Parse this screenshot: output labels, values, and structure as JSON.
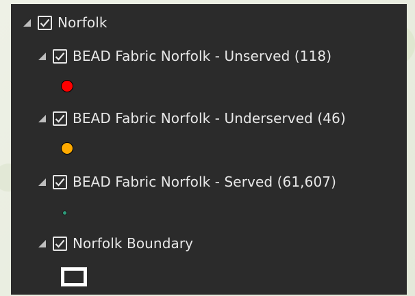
{
  "contents": {
    "group": {
      "label": "Norfolk",
      "checked": true,
      "expanded": true
    },
    "layers": [
      {
        "label": "BEAD Fabric Norfolk - Unserved (118)",
        "checked": true,
        "expanded": true,
        "symbol": {
          "shape": "circle",
          "fill": "#ff0000",
          "outline": "#000000",
          "size": "large"
        }
      },
      {
        "label": "BEAD Fabric Norfolk - Underserved (46)",
        "checked": true,
        "expanded": true,
        "symbol": {
          "shape": "circle",
          "fill": "#ffaa00",
          "outline": "#000000",
          "size": "large"
        }
      },
      {
        "label": "BEAD Fabric Norfolk - Served (61,607)",
        "checked": true,
        "expanded": true,
        "symbol": {
          "shape": "circle",
          "fill": "#2e9b7a",
          "outline": "#1a1a1a",
          "size": "small"
        }
      },
      {
        "label": "Norfolk Boundary",
        "checked": true,
        "expanded": true,
        "symbol": {
          "shape": "polygon-outline",
          "fill": "transparent",
          "outline": "#ffffff"
        }
      }
    ]
  },
  "colors": {
    "panel_background": "#2b2b2b",
    "text": "#e8e8e8",
    "checkbox_border": "#e6e6e6"
  }
}
